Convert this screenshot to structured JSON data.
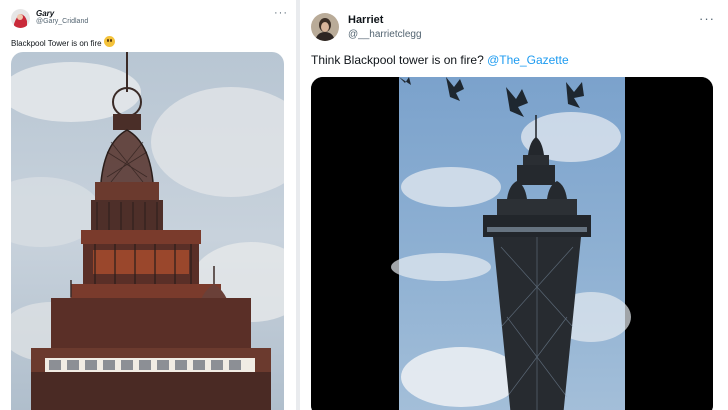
{
  "tweets": [
    {
      "name": "Gary",
      "handle": "@Gary_Cridland",
      "text": "Blackpool Tower is on fire",
      "emoji": "flushed-face-emoji",
      "image_icon": "blackpool-tower-closeup-photo"
    },
    {
      "name": "Harriet",
      "handle": "@__harrietclegg",
      "text": "Think Blackpool tower is on fire?",
      "mention": "@The_Gazette",
      "image_icon": "blackpool-tower-video-frame"
    }
  ],
  "more_icon": "ellipsis-icon",
  "colors": {
    "link": "#1d9bf0",
    "text": "#0f1419",
    "secondary": "#536471"
  }
}
